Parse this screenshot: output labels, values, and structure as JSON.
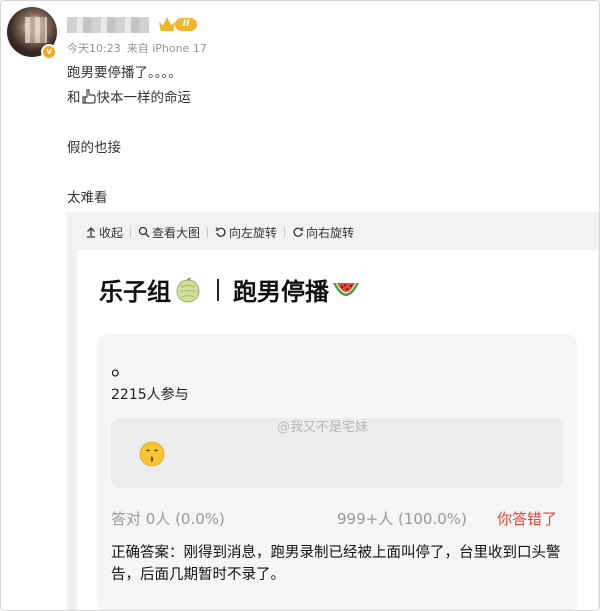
{
  "post": {
    "time": "今天10:23",
    "source": "来自 iPhone 17",
    "vip_badge": "II",
    "text_lines": [
      "跑男要停播了。。。。",
      "快本一样的命运",
      "假的也接",
      "太难看"
    ],
    "line2_prefix": "和"
  },
  "viewer": {
    "toolbar": {
      "collapse_label": "收起",
      "view_large_label": "查看大图",
      "rotate_left_label": "向左旋转",
      "rotate_right_label": "向右旋转"
    },
    "card": {
      "title_left": "乐子组",
      "title_right": "跑男停播",
      "question": "。",
      "participants": "2215人参与",
      "watermark": "@我又不是宅妹",
      "stat_correct": "答对 0人 (0.0%)",
      "stat_wrong": "999+人 (100.0%)",
      "result": "你答错了",
      "answer": "正确答案：刚得到消息，跑男录制已经被上面叫停了，台里收到口头警告，后面几期暂时不录了。"
    }
  },
  "icons": {
    "collapse": "arrow-up-icon",
    "view_large": "magnifier-icon",
    "rotate_left": "rotate-left-icon",
    "rotate_right": "rotate-right-icon",
    "hand": "pointing-hand-icon",
    "melon": "melon-emoji-icon",
    "watermelon": "watermelon-emoji-icon",
    "kiss": "kissing-face-emoji-icon",
    "verified": "verified-badge-icon",
    "crown": "crown-icon"
  },
  "colors": {
    "result_red": "#e0483b",
    "badge_gold": "#f1b52d",
    "meta_gray": "#939393"
  }
}
